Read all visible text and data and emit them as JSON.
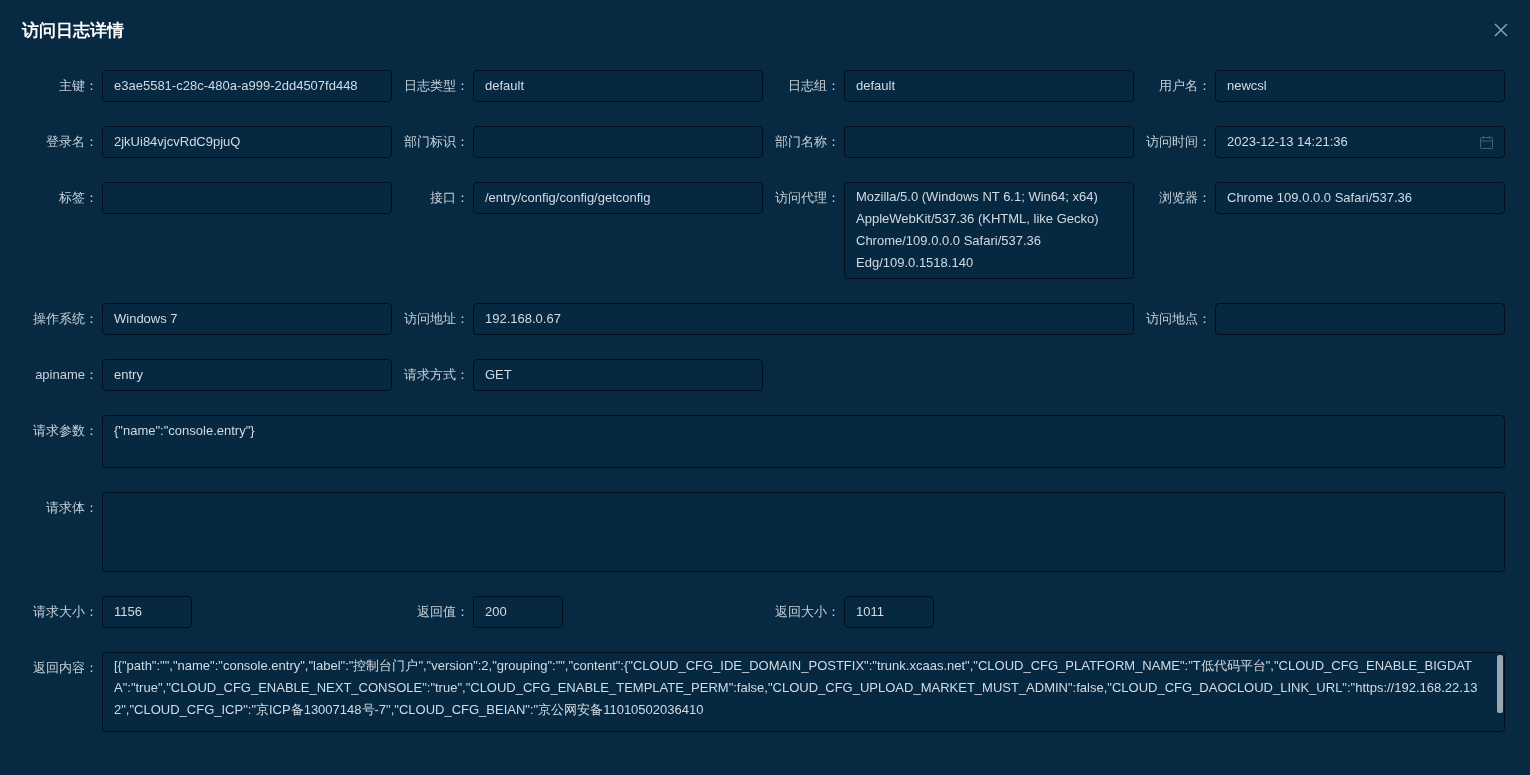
{
  "dialog": {
    "title": "访问日志详情"
  },
  "fields": [
    {
      "label": "主键：",
      "value": "e3ae5581-c28c-480a-a999-2dd4507fd448",
      "kind": "text"
    },
    {
      "label": "日志类型：",
      "value": "default",
      "kind": "text"
    },
    {
      "label": "日志组：",
      "value": "default",
      "kind": "text"
    },
    {
      "label": "用户名：",
      "value": "newcsl",
      "kind": "text"
    },
    {
      "label": "登录名：",
      "value": "2jkUi84vjcvRdC9pjuQ",
      "kind": "text"
    },
    {
      "label": "部门标识：",
      "kind": "text"
    },
    {
      "label": "部门名称：",
      "kind": "text"
    },
    {
      "label": "访问时间：",
      "value": "2023-12-13 14:21:36",
      "kind": "date"
    },
    {
      "label": "标签：",
      "kind": "text"
    },
    {
      "label": "接口：",
      "value": "/entry/config/config/getconfig",
      "kind": "text"
    },
    {
      "label": "访问代理：",
      "value": "Mozilla/5.0 (Windows NT 6.1; Win64; x64) AppleWebKit/537.36 (KHTML, like Gecko) Chrome/109.0.0.0 Safari/537.36 Edg/109.0.1518.140",
      "kind": "multiline"
    },
    {
      "label": "浏览器：",
      "value": "Chrome 109.0.0.0 Safari/537.36",
      "kind": "text"
    },
    {
      "label": "操作系统：",
      "value": "Windows 7",
      "kind": "text"
    },
    {
      "label": "访问地址：",
      "value": "192.168.0.67",
      "kind": "wide"
    },
    {
      "label": "访问地点：",
      "kind": "text"
    },
    {
      "label": "apiname：",
      "value": "entry",
      "kind": "text"
    },
    {
      "label": "请求方式：",
      "value": "GET",
      "kind": "text"
    },
    {
      "label": "请求参数：",
      "value": "{\"name\":\"console.entry\"}",
      "kind": "area"
    },
    {
      "label": "请求体：",
      "kind": "tallarea"
    },
    {
      "label": "请求大小：",
      "value": "1156",
      "kind": "short"
    },
    {
      "label": "返回值：",
      "value": "200",
      "kind": "short"
    },
    {
      "label": "返回大小：",
      "value": "1011",
      "kind": "short"
    },
    {
      "label": "返回内容：",
      "value": "[{\"path\":\"\",\"name\":\"console.entry\",\"label\":\"控制台门户\",\"version\":2,\"grouping\":\"\",\"content\":{\"CLOUD_CFG_IDE_DOMAIN_POSTFIX\":\"trunk.xcaas.net\",\"CLOUD_CFG_PLATFORM_NAME\":\"T低代码平台\",\"CLOUD_CFG_ENABLE_BIGDATA\":\"true\",\"CLOUD_CFG_ENABLE_NEXT_CONSOLE\":\"true\",\"CLOUD_CFG_ENABLE_TEMPLATE_PERM\":false,\"CLOUD_CFG_UPLOAD_MARKET_MUST_ADMIN\":false,\"CLOUD_CFG_DAOCLOUD_LINK_URL\":\"https://192.168.22.132\",\"CLOUD_CFG_ICP\":\"京ICP备13007148号-7\",\"CLOUD_CFG_BEIAN\":\"京公网安备11010502036410",
      "kind": "code"
    }
  ]
}
